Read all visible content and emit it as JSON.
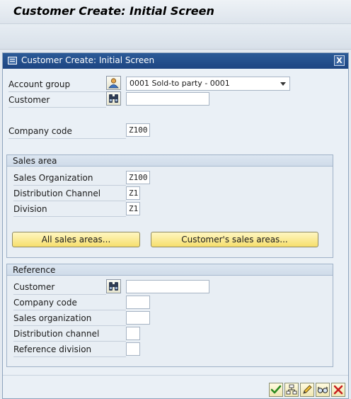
{
  "window": {
    "title": "Customer Create: Initial Screen"
  },
  "dialog": {
    "title": "Customer Create: Initial Screen",
    "close_label": "X"
  },
  "top_fields": {
    "account_group_label": "Account group",
    "account_group_value": "0001 Sold-to party - 0001",
    "customer_label": "Customer",
    "customer_value": "",
    "company_code_label": "Company code",
    "company_code_value": "Z100"
  },
  "sales_area": {
    "title": "Sales area",
    "sales_org_label": "Sales Organization",
    "sales_org_value": "Z100",
    "dist_channel_label": "Distribution Channel",
    "dist_channel_value": "Z1",
    "division_label": "Division",
    "division_value": "Z1",
    "all_sales_areas_button": "All sales areas...",
    "customers_sales_areas_button": "Customer's sales areas..."
  },
  "reference": {
    "title": "Reference",
    "customer_label": "Customer",
    "customer_value": "",
    "company_code_label": "Company code",
    "company_code_value": "",
    "sales_org_label": "Sales organization",
    "sales_org_value": "",
    "dist_channel_label": "Distribution channel",
    "dist_channel_value": "",
    "ref_division_label": "Reference division",
    "ref_division_value": ""
  },
  "footer_buttons": [
    "confirm-icon",
    "hierarchy-icon",
    "edit-pencil-icon",
    "glasses-icon",
    "cancel-icon"
  ],
  "colors": {
    "header_blue": "#1d4582",
    "button_yellow": "#f6de6c",
    "confirm_green": "#2a8a1f",
    "cancel_red": "#c81e1e"
  }
}
